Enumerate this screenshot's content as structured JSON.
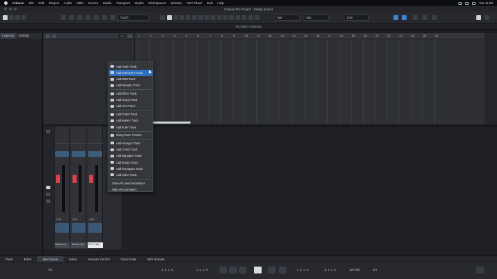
{
  "menubar": {
    "app": "Cubase",
    "items": [
      "File",
      "Edit",
      "Project",
      "Audio",
      "MIDI",
      "Scores",
      "Media",
      "Transport",
      "Studio",
      "Workspaces",
      "Window",
      "VST Cloud",
      "Hub",
      "Help"
    ],
    "clock": "Tue 11:03"
  },
  "window": {
    "title": "Cubase Pro Project - Empty project"
  },
  "toolbar": {
    "mode_label": "Touch",
    "grid_label": "Bar",
    "quantize_label": "Bar",
    "note_label": "1/16"
  },
  "infoline": {
    "text": "No Object Selected"
  },
  "left_zone": {
    "tabs": [
      "Inspector",
      "Visibility"
    ]
  },
  "track_list": {
    "field_value": "0/0"
  },
  "ruler": {
    "marks": [
      "1",
      "2",
      "3",
      "4",
      "5",
      "6",
      "7",
      "8",
      "9",
      "10",
      "11",
      "12",
      "13",
      "14",
      "15",
      "16",
      "17",
      "18",
      "19",
      "20",
      "21",
      "22",
      "23",
      "24",
      "25",
      "26"
    ]
  },
  "context_menu": {
    "items": [
      {
        "label": "Add Audio Track",
        "icon": "audio-track-icon"
      },
      {
        "label": "Add Instrument Track",
        "icon": "instrument-track-icon",
        "highlighted": true
      },
      {
        "label": "Add MIDI Track",
        "icon": "midi-track-icon"
      },
      {
        "label": "Add Sampler Track",
        "icon": "sampler-track-icon"
      },
      {
        "label": "Add Effect Track",
        "icon": "effect-track-icon"
      },
      {
        "label": "Add Group Track",
        "icon": "group-track-icon"
      },
      {
        "label": "Add VCA Track",
        "icon": "vca-track-icon"
      },
      {
        "label": "Add Folder Track",
        "icon": "folder-track-icon"
      },
      {
        "label": "Add Marker Track",
        "icon": "marker-track-icon"
      },
      {
        "label": "Add Ruler Track",
        "icon": "ruler-track-icon"
      },
      {
        "label": "Using Track Presets",
        "icon": "track-preset-icon"
      },
      {
        "label": "Add Arranger Track",
        "icon": "arranger-track-icon"
      },
      {
        "label": "Add Chord Track",
        "icon": "chord-track-icon"
      },
      {
        "label": "Add Signature Track",
        "icon": "signature-track-icon"
      },
      {
        "label": "Add Tempo Track",
        "icon": "tempo-track-icon"
      },
      {
        "label": "Add Transpose Track",
        "icon": "transpose-track-icon"
      },
      {
        "label": "Add Video Track",
        "icon": "video-track-icon"
      },
      {
        "label": "Show All Used Automation"
      },
      {
        "label": "Hide All Automation"
      }
    ]
  },
  "mixer": {
    "strips": [
      {
        "value": "0.00",
        "name": "Stereo In"
      },
      {
        "value": "0.00",
        "name": "Stereo Out"
      },
      {
        "value": "0.00",
        "name": "FX 1-Hall"
      }
    ]
  },
  "lower_tabs": [
    "Track",
    "Editor",
    "MixConsole",
    "Editor",
    "Sampler Control",
    "Chord Pads",
    "MIDI Remote"
  ],
  "transport": {
    "left_value": "AC",
    "position_primary": "1. 1. 1. 0",
    "position_secondary": "1. 1. 1. 0",
    "locator_left": "1. 1. 1. 0",
    "locator_right": "1. 1. 1. 0",
    "tempo": "120.000",
    "signature": "4/4"
  }
}
